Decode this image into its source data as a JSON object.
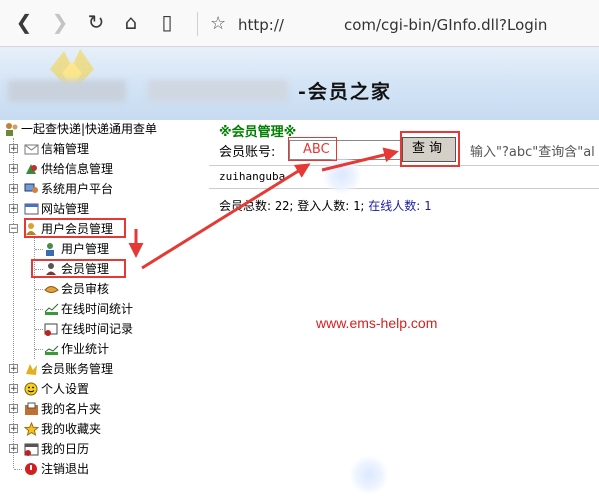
{
  "browser": {
    "url_prefix": "http://",
    "url_suffix": "com/cgi-bin/GInfo.dll?Login",
    "icons": [
      "back-icon",
      "forward-icon",
      "reload-icon",
      "home-icon",
      "reader-icon",
      "star-icon"
    ]
  },
  "banner": {
    "title": "-会员之家"
  },
  "sidebar": {
    "root": "一起查快递|快递通用查单",
    "items": [
      {
        "label": "信箱管理"
      },
      {
        "label": "供给信息管理"
      },
      {
        "label": "系统用户平台"
      },
      {
        "label": "网站管理"
      },
      {
        "label": "用户会员管理"
      },
      {
        "label": "用户管理"
      },
      {
        "label": "会员管理"
      },
      {
        "label": "会员审核"
      },
      {
        "label": "在线时间统计"
      },
      {
        "label": "在线时间记录"
      },
      {
        "label": "作业统计"
      },
      {
        "label": "会员账务管理"
      },
      {
        "label": "个人设置"
      },
      {
        "label": "我的名片夹"
      },
      {
        "label": "我的收藏夹"
      },
      {
        "label": "我的日历"
      },
      {
        "label": "注销退出"
      }
    ]
  },
  "main": {
    "section_title": "※会员管理※",
    "account_label": "会员账号:",
    "account_value": "ABC",
    "search_button": "查询",
    "hint": "输入\"?abc\"查询含\"al",
    "member_name": "zuihanguba",
    "stats": {
      "members_label": "会员总数:",
      "members_value": "22",
      "logins_label": "登入人数:",
      "logins_value": "1",
      "online_label": "在线人数:",
      "online_value": "1",
      "sep": ";"
    },
    "watermark": "www.ems-help.com"
  },
  "colors": {
    "accent_red": "#e53935",
    "title_green": "#008000",
    "online_blue": "#1a1aa6"
  }
}
